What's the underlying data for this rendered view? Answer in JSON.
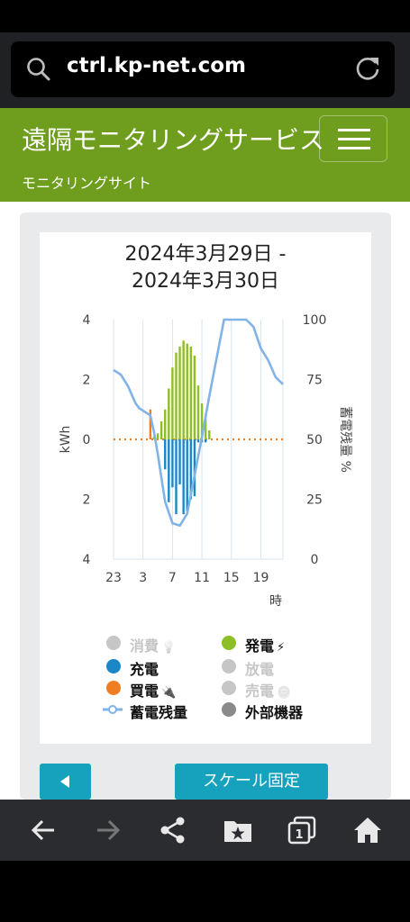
{
  "browser": {
    "url": "ctrl.kp-net.com"
  },
  "site": {
    "title": "遠隔モニタリングサービス",
    "subtitle": "モニタリングサイト"
  },
  "chart_data": {
    "type": "bar",
    "title_line1": "2024年3月29日 -",
    "title_line2": "2024年3月30日",
    "y_left_label": "kWh",
    "y_right_label": "蓄電残量 %",
    "x_unit": "時",
    "y_left_ticks": [
      "4",
      "2",
      "0",
      "2",
      "4"
    ],
    "y_right_ticks": [
      "100",
      "75",
      "50",
      "25",
      "0"
    ],
    "x_ticks": [
      "23",
      "3",
      "7",
      "11",
      "15",
      "19"
    ],
    "ylim_left": [
      -4,
      4
    ],
    "ylim_right": [
      0,
      100
    ],
    "x_range": [
      0,
      23
    ],
    "colors": {
      "generation": "#8cbf26",
      "charge": "#1b87c9",
      "purchase": "#f07d22",
      "battery": "#82b3e6"
    },
    "series": [
      {
        "name": "発電",
        "points": [
          [
            5.5,
            0.1
          ],
          [
            6.0,
            0.2
          ],
          [
            6.5,
            0.6
          ],
          [
            7.0,
            1.0
          ],
          [
            7.5,
            1.7
          ],
          [
            8.0,
            2.4
          ],
          [
            8.5,
            2.9
          ],
          [
            9.0,
            3.1
          ],
          [
            9.5,
            3.3
          ],
          [
            10.0,
            3.2
          ],
          [
            10.5,
            3.1
          ],
          [
            11.0,
            2.8
          ],
          [
            11.5,
            1.8
          ],
          [
            12.0,
            1.2
          ],
          [
            12.5,
            0.7
          ],
          [
            13.0,
            0.3
          ]
        ]
      },
      {
        "name": "充電",
        "points": [
          [
            7.0,
            -1.0
          ],
          [
            7.5,
            -2.1
          ],
          [
            8.0,
            -1.6
          ],
          [
            8.5,
            -2.5
          ],
          [
            9.0,
            -1.5
          ],
          [
            9.5,
            -2.5
          ],
          [
            10.0,
            -2.4
          ],
          [
            10.5,
            -2.0
          ],
          [
            11.0,
            -1.9
          ],
          [
            11.5,
            -0.1
          ],
          [
            12.0,
            -0.1
          ],
          [
            12.5,
            -0.1
          ]
        ]
      },
      {
        "name": "買電",
        "points": [
          [
            5.0,
            1.0
          ]
        ]
      },
      {
        "name": "蓄電残量",
        "x": [
          0,
          1,
          2,
          3,
          3.5,
          4,
          4.5,
          5,
          5.5,
          6,
          6.5,
          7,
          8,
          9,
          10,
          11,
          12,
          13,
          14,
          15,
          16,
          17,
          18,
          19,
          20,
          21,
          22,
          23
        ],
        "y": [
          79,
          77,
          72,
          65,
          63,
          62,
          61,
          60,
          53,
          44,
          34,
          24,
          15,
          14,
          19,
          35,
          51,
          68,
          84,
          100,
          100,
          100,
          100,
          97,
          88,
          83,
          76,
          73
        ]
      }
    ]
  },
  "legend": [
    {
      "label": "消費",
      "icon": "lightbulb-icon",
      "color": "#c6c6c6",
      "active": false
    },
    {
      "label": "発電",
      "icon": "lightning-icon",
      "color": "#8cbf26",
      "active": true
    },
    {
      "label": "充電",
      "icon": "",
      "color": "#1b87c9",
      "active": true
    },
    {
      "label": "放電",
      "icon": "",
      "color": "#c6c6c6",
      "active": false
    },
    {
      "label": "買電",
      "icon": "plug-icon",
      "color": "#f07d22",
      "active": true
    },
    {
      "label": "売電",
      "icon": "coins-icon",
      "color": "#c6c6c6",
      "active": false
    },
    {
      "label": "蓄電残量",
      "icon": "line-marker-icon",
      "color": "#82b3e6",
      "active": true
    },
    {
      "label": "外部機器",
      "icon": "",
      "color": "#8a8a8a",
      "active": true
    }
  ],
  "buttons": {
    "scale_fixed": "スケール固定"
  }
}
